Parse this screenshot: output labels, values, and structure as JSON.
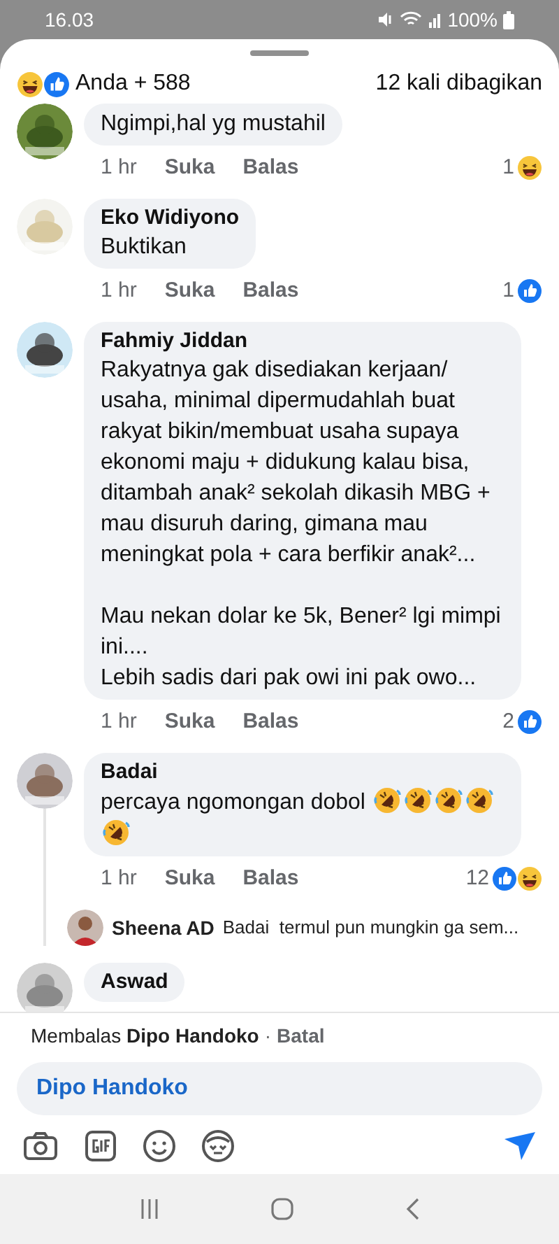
{
  "status_bar": {
    "time": "16.03",
    "battery": "100%"
  },
  "header": {
    "reactions": [
      {
        "kind": "haha"
      },
      {
        "kind": "like"
      }
    ],
    "reacted_by": "Anda + 588",
    "shares": "12 kali dibagikan"
  },
  "comments": [
    {
      "text": "Ngimpi,hal yg mustahil",
      "time": "1 hr",
      "like": "Suka",
      "reply": "Balas",
      "count": "1",
      "reactions": [
        {
          "kind": "haha"
        }
      ]
    },
    {
      "name": "Eko Widiyono",
      "text": "Buktikan",
      "time": "1 hr",
      "like": "Suka",
      "reply": "Balas",
      "count": "1",
      "reactions": [
        {
          "kind": "like"
        }
      ]
    },
    {
      "name": "Fahmiy Jiddan",
      "text": "Rakyatnya gak disediakan kerjaan/ usaha, minimal dipermudahlah buat rakyat bikin/membuat usaha supaya ekonomi maju + didukung kalau bisa, ditambah anak² sekolah dikasih MBG + mau disuruh daring, gimana mau meningkat pola + cara berfikir anak²...\n\nMau nekan dolar ke 5k, Bener² lgi mimpi ini....\nLebih sadis dari pak owi ini pak owo...",
      "time": "1 hr",
      "like": "Suka",
      "reply": "Balas",
      "count": "2",
      "reactions": [
        {
          "kind": "like"
        }
      ]
    },
    {
      "name": "Badai",
      "text": "percaya ngomongan dobol",
      "emojis": [
        {
          "kind": "rofl"
        },
        {
          "kind": "rofl"
        },
        {
          "kind": "rofl"
        },
        {
          "kind": "rofl"
        },
        {
          "kind": "rofl"
        }
      ],
      "time": "1 hr",
      "like": "Suka",
      "reply": "Balas",
      "count": "12",
      "reactions": [
        {
          "kind": "like"
        },
        {
          "kind": "haha"
        }
      ],
      "reply_preview": {
        "name": "Sheena AD",
        "text": "Badai  termul pun mungkin ga sem..."
      }
    },
    {
      "name": "Aswad"
    }
  ],
  "composer": {
    "prefix": "Membalas",
    "target": "Dipo Handoko",
    "separator": "·",
    "cancel": "Batal",
    "value": "Dipo Handoko"
  }
}
